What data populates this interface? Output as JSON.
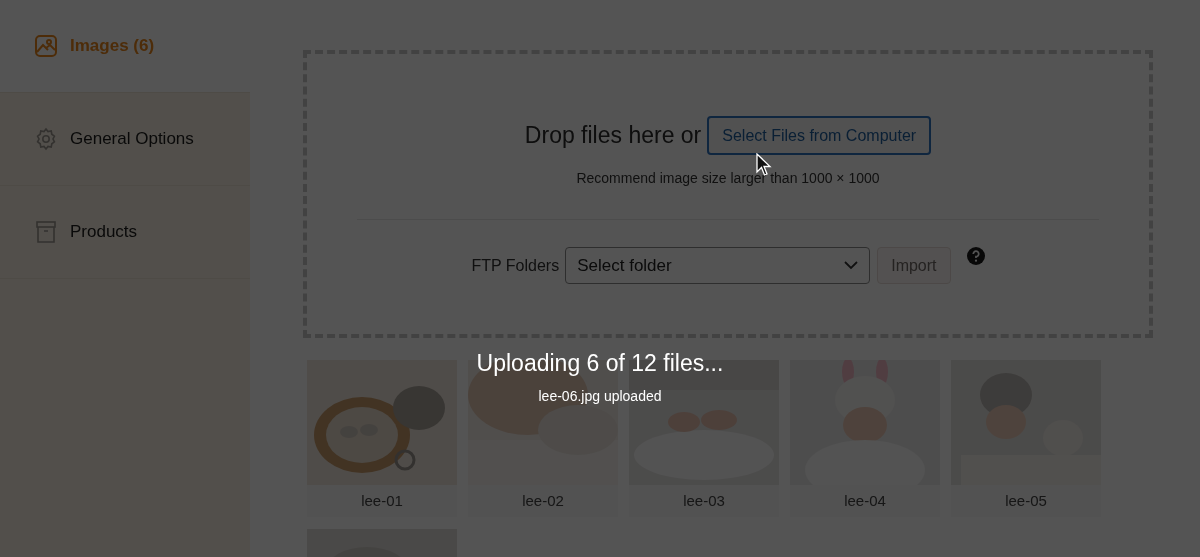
{
  "sidebar": {
    "items": [
      {
        "kind": "images",
        "label": "Images (6)",
        "selected": true
      },
      {
        "kind": "settings",
        "label": "General Options",
        "selected": false
      },
      {
        "kind": "products",
        "label": "Products",
        "selected": false
      }
    ]
  },
  "dropzone": {
    "drop_text": "Drop files here or",
    "select_button": "Select Files from Computer",
    "hint": "Recommend image size larger than 1000 × 1000",
    "ftp_label": "FTP Folders",
    "folder_select": {
      "value": "Select folder"
    },
    "import_button": {
      "label": "Import",
      "disabled": true
    }
  },
  "images": [
    {
      "kind": "picture",
      "caption": "lee-01"
    },
    {
      "kind": "picture",
      "caption": "lee-02"
    },
    {
      "kind": "picture",
      "caption": "lee-03"
    },
    {
      "kind": "picture",
      "caption": "lee-04"
    },
    {
      "kind": "picture",
      "caption": "lee-05"
    },
    {
      "kind": "picture"
    }
  ],
  "upload_progress": {
    "title": "Uploading 6 of 12 files...",
    "detail": "lee-06.jpg uploaded"
  }
}
